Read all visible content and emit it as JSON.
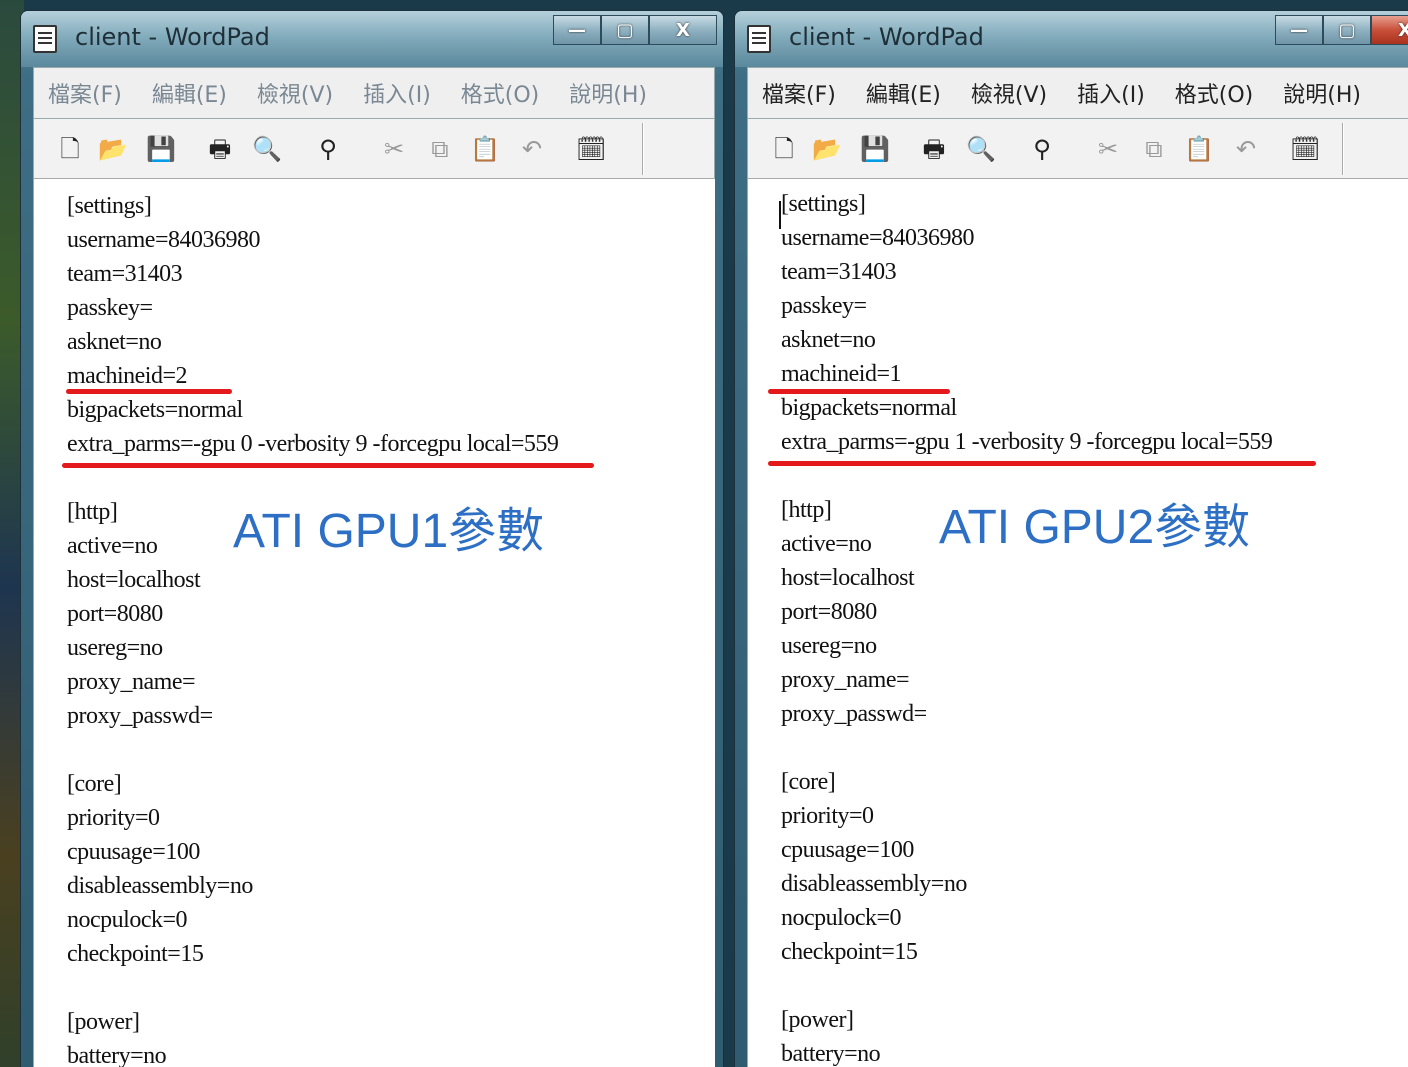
{
  "left_window": {
    "title": "client - WordPad",
    "buttons": {
      "minimize": "—",
      "maximize": "▢",
      "close": "X"
    },
    "menu": [
      "檔案(F)",
      "編輯(E)",
      "檢視(V)",
      "插入(I)",
      "格式(O)",
      "說明(H)"
    ],
    "annotation": "ATI GPU1參數",
    "lines": [
      "[settings]",
      "username=84036980",
      "team=31403",
      "passkey=",
      "asknet=no",
      "machineid=2",
      "bigpackets=normal",
      "extra_parms=-gpu 0 -verbosity 9 -forcegpu local=559",
      "",
      "[http]",
      "active=no",
      "host=localhost",
      "port=8080",
      "usereg=no",
      "proxy_name=",
      "proxy_passwd=",
      "",
      "[core]",
      "priority=0",
      "cpuusage=100",
      "disableassembly=no",
      "nocpulock=0",
      "checkpoint=15",
      "",
      "[power]",
      "battery=no"
    ]
  },
  "right_window": {
    "title": "client - WordPad",
    "buttons": {
      "minimize": "—",
      "maximize": "▢",
      "close": "X"
    },
    "menu": [
      "檔案(F)",
      "編輯(E)",
      "檢視(V)",
      "插入(I)",
      "格式(O)",
      "說明(H)"
    ],
    "annotation": "ATI GPU2參數",
    "lines": [
      "[settings]",
      "username=84036980",
      "team=31403",
      "passkey=",
      "asknet=no",
      "machineid=1",
      "bigpackets=normal",
      "extra_parms=-gpu 1 -verbosity 9 -forcegpu local=559",
      "",
      "[http]",
      "active=no",
      "host=localhost",
      "port=8080",
      "usereg=no",
      "proxy_name=",
      "proxy_passwd=",
      "",
      "[core]",
      "priority=0",
      "cpuusage=100",
      "disableassembly=no",
      "nocpulock=0",
      "checkpoint=15",
      "",
      "[power]",
      "battery=no"
    ]
  },
  "toolbar_icons": [
    "new-icon",
    "open-icon",
    "save-icon",
    "print-icon",
    "print-preview-icon",
    "find-icon",
    "cut-icon",
    "copy-icon",
    "paste-icon",
    "undo-icon",
    "date-time-icon"
  ],
  "colors": {
    "highlight_underline": "#e3191b",
    "annotation": "#2d6fc4"
  }
}
